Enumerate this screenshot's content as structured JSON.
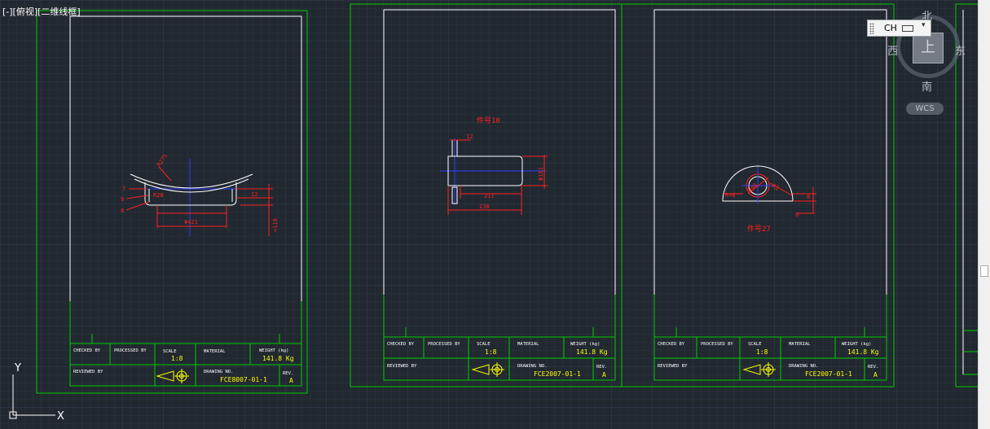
{
  "viewport": {
    "label": "[-][俯视][二维线框]"
  },
  "view_cube": {
    "north": "北",
    "south": "南",
    "east": "东",
    "west": "西",
    "face": "上",
    "coord_system": "WCS"
  },
  "ime": {
    "language": "CH"
  },
  "ucs": {
    "y_label": "Y",
    "x_label": "X"
  },
  "title_block": {
    "checked_by": "CHECKED BY",
    "processed_by": "PROCESSED BY",
    "reviewed_by": "REVIEWED BY",
    "scale_label": "SCALE",
    "scale_value": "1:8",
    "material_label": "MATERIAL",
    "weight_label": "WEIGHT (kg)",
    "weight_value": "141.8 Kg",
    "drawing_no_label": "DRAWING NO.",
    "rev_label": "REV.",
    "rev_value": "A"
  },
  "sheets": [
    {
      "drawing_no": "FCE8007-01-1",
      "part_label": ""
    },
    {
      "drawing_no": "FCE2007-01-1",
      "part_label": "件号10"
    },
    {
      "drawing_no": "FCE2007-01-1",
      "part_label": "件号27"
    }
  ],
  "dimensions": {
    "s1_r275": "R275",
    "s1_r28": "R28",
    "s1_7": "7",
    "s1_9": "9",
    "s1_8": "8",
    "s1_12": "12",
    "s1_phi421": "Φ421",
    "s1_118": "≈118",
    "s2_12": "12",
    "s2_211": "211",
    "s2_238": "238",
    "s2_phi101": "Φ101",
    "s3_r8": "R=8",
    "s3_r40": "R40",
    "s3_r2": "R2",
    "s3_8": "8",
    "s3_8b": "8"
  },
  "colors": {
    "sheet_frame": "#00cc00",
    "border": "#ffffff",
    "dimension": "#ff2020",
    "centerline": "#2e3cff",
    "symbol": "#ffff00"
  }
}
